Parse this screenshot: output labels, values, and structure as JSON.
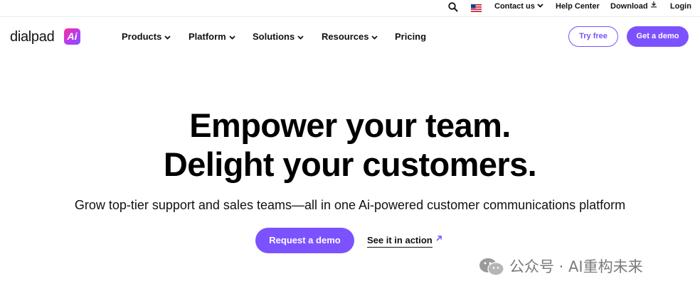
{
  "utility_bar": {
    "icons": {
      "search": "search-icon",
      "flag": "us-flag-icon"
    },
    "contact_label": "Contact us",
    "help_label": "Help Center",
    "download_label": "Download",
    "login_label": "Login"
  },
  "header": {
    "logo_text": "dialpad",
    "logo_badge": "Ai",
    "nav": {
      "products": "Products",
      "platform": "Platform",
      "solutions": "Solutions",
      "resources": "Resources",
      "pricing": "Pricing"
    },
    "try_free_label": "Try free",
    "get_demo_label": "Get a demo"
  },
  "hero": {
    "headline_line1": "Empower your team.",
    "headline_line2": "Delight your customers.",
    "subtitle": "Grow top-tier support and sales teams—all in one Ai-powered customer communications platform",
    "request_demo_label": "Request a demo",
    "see_action_label": "See it in action"
  },
  "watermark": {
    "text": "公众号 · AI重构未来"
  },
  "colors": {
    "brand_purple": "#7c52ff",
    "text": "#111111"
  }
}
